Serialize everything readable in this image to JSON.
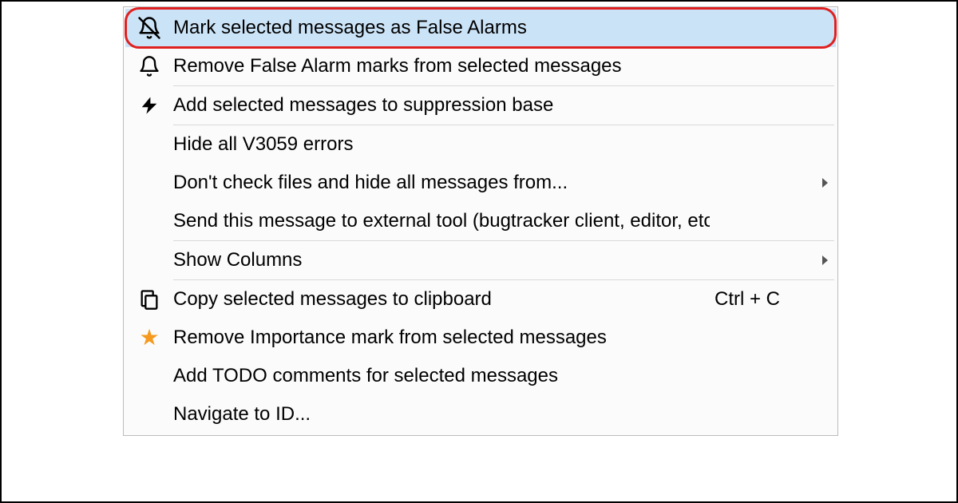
{
  "menu": {
    "items": [
      {
        "label": "Mark selected messages as False Alarms",
        "shortcut": "",
        "submenu": false,
        "highlighted": true
      },
      {
        "label": "Remove False Alarm marks from selected messages",
        "shortcut": "",
        "submenu": false,
        "highlighted": false
      },
      {
        "label": "Add selected messages to suppression base",
        "shortcut": "",
        "submenu": false,
        "highlighted": false
      },
      {
        "label": "Hide all V3059 errors",
        "shortcut": "",
        "submenu": false,
        "highlighted": false
      },
      {
        "label": "Don't check files and hide all messages from...",
        "shortcut": "",
        "submenu": true,
        "highlighted": false
      },
      {
        "label": "Send this message to external tool (bugtracker client, editor, etc.)",
        "shortcut": "",
        "submenu": false,
        "highlighted": false
      },
      {
        "label": "Show Columns",
        "shortcut": "",
        "submenu": true,
        "highlighted": false
      },
      {
        "label": "Copy selected messages to clipboard",
        "shortcut": "Ctrl + C",
        "submenu": false,
        "highlighted": false
      },
      {
        "label": "Remove Importance mark from selected messages",
        "shortcut": "",
        "submenu": false,
        "highlighted": false
      },
      {
        "label": "Add TODO comments for selected messages",
        "shortcut": "",
        "submenu": false,
        "highlighted": false
      },
      {
        "label": "Navigate to ID...",
        "shortcut": "",
        "submenu": false,
        "highlighted": false
      }
    ],
    "icons": {
      "0": "bell-slash-icon",
      "1": "bell-icon",
      "2": "lightning-icon",
      "7": "copy-icon",
      "8": "star-icon"
    },
    "highlight_color": "#cbe3f7",
    "highlight_ring_color": "#e02020"
  }
}
